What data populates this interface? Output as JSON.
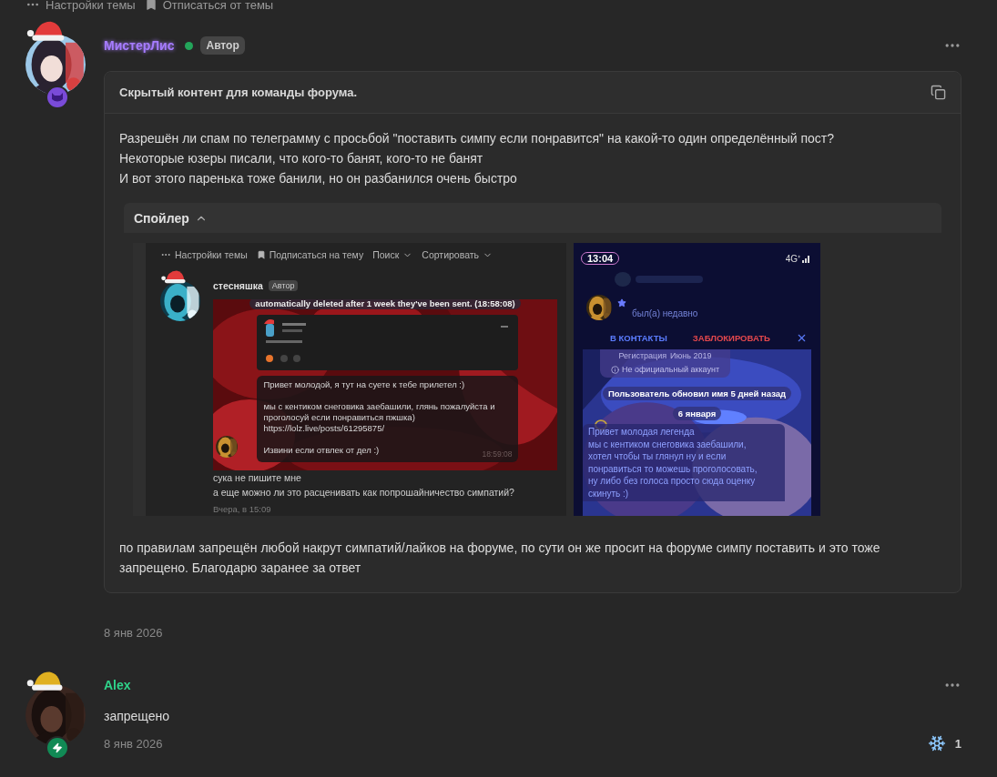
{
  "topbar": [
    {
      "kind": "dots",
      "label": "Настройки темы"
    },
    {
      "kind": "bookmark",
      "label": "Отписаться от темы"
    }
  ],
  "posts": [
    {
      "kind": "hidden",
      "author": "МистерЛис",
      "color": "#a67cff",
      "online": true,
      "badge": "Автор",
      "hidden_title": "Скрытый контент для команды форума.",
      "lines": [
        "Разрешён ли спам по телеграмму с просьбой \"поставить симпу если понравится\" на какой-то один определённый пост?",
        "Некоторые юзеры писали, что кого-то банят, кого-то не банят",
        "И вот этого паренька тоже банили, но он разбанился очень быстро"
      ],
      "spoiler": {
        "title": "Спойлер",
        "expanded": true,
        "shots": [
          {
            "kind": "forum",
            "toolbar": [
              {
                "kind": "dots",
                "label": "Настройки темы"
              },
              {
                "kind": "bookmark",
                "label": "Подписаться на тему"
              },
              {
                "kind": "menu",
                "label": "Поиск"
              },
              {
                "kind": "menu",
                "label": "Сортировать"
              }
            ],
            "author": "стесняшка",
            "badge": "Автор",
            "notice": "automatically deleted after 1 week they've been sent. (18:58:08)",
            "message": [
              "Привет молодой, я тут на суете к тебе прилетел :)",
              "мы с кентиком снеговика заебашили, глянь пожалуйста и проголосуй если понравиться пжшка)",
              "https://lolz.live/posts/61295875/",
              "Извини если отвлек от дел :)"
            ],
            "message_time": "18:59:08",
            "comment": [
              "сука не пишите мне",
              "а еще можно ли это расценивать как попрошайничество симпатий?"
            ],
            "date": "Вчера, в 15:09"
          },
          {
            "kind": "phone",
            "time": "13:04",
            "network": "4G⁺",
            "status": "был(а) недавно",
            "actions": [
              {
                "label": "В КОНТАКТЫ",
                "color": "#5b7cff"
              },
              {
                "label": "ЗАБЛОКИРОВАТЬ",
                "color": "#e5484d"
              }
            ],
            "registration": [
              "Регистрация",
              "Июнь 2019"
            ],
            "official": "Не официальный аккаунт",
            "service": "Пользователь обновил имя 5 дней назад",
            "date_chip": "6 января",
            "message": [
              "Привет молодая легенда",
              "мы с кентиком снеговика заебашили,",
              "хотел чтобы ты глянул ну и если",
              "понравиться то можешь проголосовать,",
              "ну либо без голоса просто сюда оценку",
              "скинуть :)"
            ]
          }
        ]
      },
      "after": "по правилам запрещён любой накрут симпатий/лайков на форуме, по сути он же просит на форуме симпу поставить и это тоже запрещено. Благодарю заранее за ответ",
      "date": "8 янв 2026"
    },
    {
      "kind": "plain",
      "author": "Alex",
      "color": "#2fd38a",
      "text": "запрещено",
      "date": "8 янв 2026",
      "reaction": "1"
    }
  ]
}
